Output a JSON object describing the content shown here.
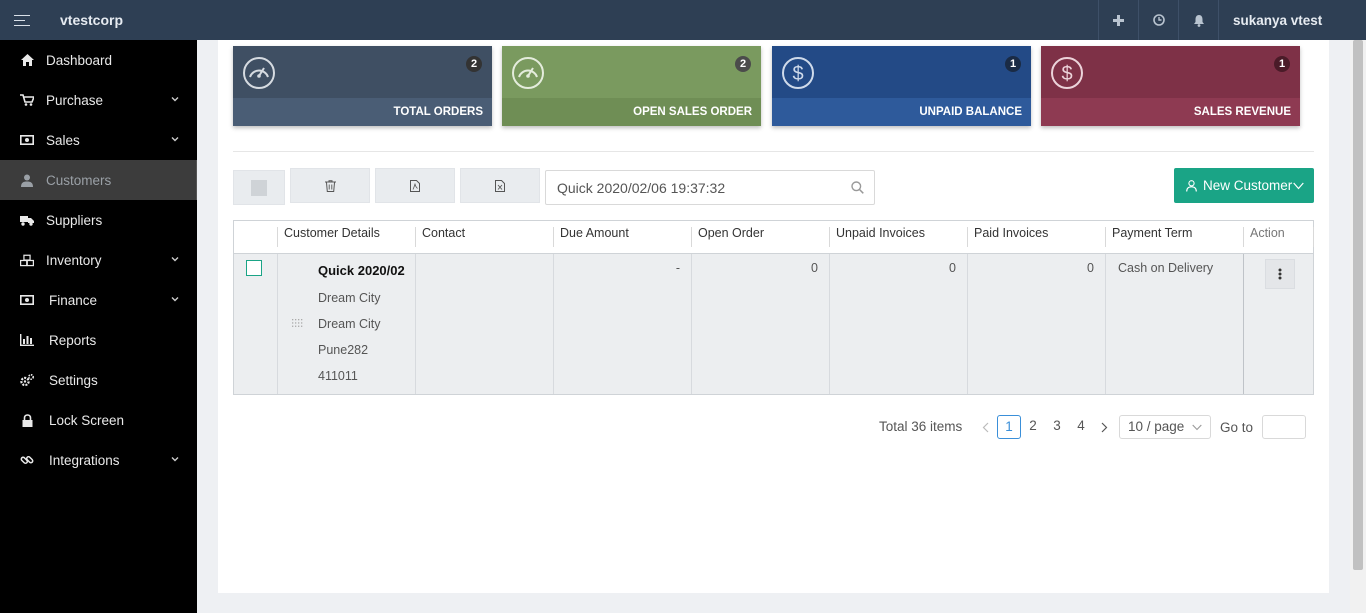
{
  "header": {
    "brand": "vtestcorp",
    "user": "sukanya vtest",
    "icons": [
      "plus-icon",
      "clock-icon",
      "bell-icon"
    ]
  },
  "sidebar": {
    "items": [
      {
        "label": "Dashboard",
        "icon": "home-icon",
        "expandable": false
      },
      {
        "label": "Purchase",
        "icon": "cart-icon",
        "expandable": true
      },
      {
        "label": "Sales",
        "icon": "money-icon",
        "expandable": true
      },
      {
        "label": "Customers",
        "icon": "user-icon",
        "expandable": false,
        "active": true
      },
      {
        "label": "Suppliers",
        "icon": "truck-icon",
        "expandable": false
      },
      {
        "label": "Inventory",
        "icon": "cubes-icon",
        "expandable": true
      },
      {
        "label": "Finance",
        "icon": "money-icon",
        "expandable": true
      },
      {
        "label": "Reports",
        "icon": "bar-chart-icon",
        "expandable": false
      },
      {
        "label": "Settings",
        "icon": "gears-icon",
        "expandable": false
      },
      {
        "label": "Lock Screen",
        "icon": "lock-icon",
        "expandable": false
      },
      {
        "label": "Integrations",
        "icon": "link-icon",
        "expandable": true
      }
    ]
  },
  "cards": [
    {
      "label": "TOTAL ORDERS",
      "count": "2",
      "icon": "speedometer-icon",
      "color": "#3f4f63",
      "foot": "#4a5d75",
      "badge": "#333"
    },
    {
      "label": "OPEN SALES ORDER",
      "count": "2",
      "icon": "speedometer-icon",
      "color": "#7a9a5f",
      "foot": "#6f8e55",
      "badge": "#4b4b4b"
    },
    {
      "label": "UNPAID BALANCE",
      "count": "1",
      "icon": "dollar-icon",
      "color": "#234a86",
      "foot": "#2e5a9b",
      "badge": "#1a2b45"
    },
    {
      "label": "SALES REVENUE",
      "count": "1",
      "icon": "dollar-icon",
      "color": "#7e3147",
      "foot": "#8e3a52",
      "badge": "#4a1b28"
    }
  ],
  "toolbar": {
    "buttons": [
      "trash-icon",
      "pdf-icon",
      "excel-icon"
    ],
    "search_value": "Quick 2020/02/06 19:37:32",
    "new_customer_label": "New Customer"
  },
  "table": {
    "columns": [
      "Customer Details",
      "Contact",
      "Due Amount",
      "Open Order",
      "Unpaid Invoices",
      "Paid Invoices",
      "Payment Term",
      "Action"
    ],
    "row": {
      "name": "Quick 2020/02",
      "address": [
        "Dream City",
        "Dream City",
        "Pune282",
        "411011"
      ],
      "contact": "",
      "due_amount": "-",
      "open_order": "0",
      "unpaid_invoices": "0",
      "paid_invoices": "0",
      "payment_term": "Cash on Delivery"
    }
  },
  "pagination": {
    "total": "Total 36 items",
    "pages": [
      "1",
      "2",
      "3",
      "4"
    ],
    "current": "1",
    "page_size": "10 / page",
    "goto_label": "Go to"
  }
}
